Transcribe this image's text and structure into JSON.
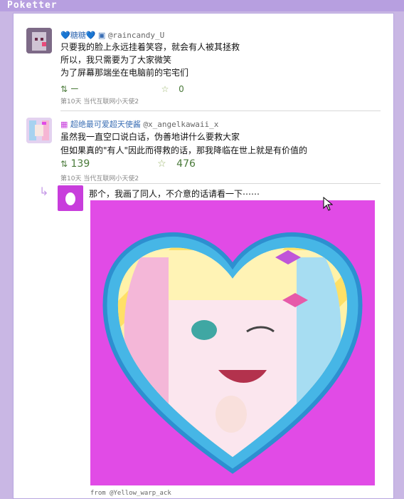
{
  "app": {
    "title": "Poketter"
  },
  "posts": [
    {
      "name": "💙糖糖💙",
      "handle": "@raincandy_U",
      "lines": [
        "只要我的脸上永远挂着笑容，就会有人被其拯救",
        "所以，我只需要为了大家微笑",
        "为了屏幕那端坐在电脑前的宅宅们"
      ],
      "retweets": "ー",
      "likes": "0",
      "meta": "第10天 当代互联网小天使2"
    },
    {
      "name": "超绝最可爱超天使酱",
      "handle": "@x_angelkawaii_x",
      "lines": [
        "虽然我一直空口说白话，伪善地讲什么要救大家",
        "但如果真的\"有人\"因此而得救的话，那我降临在世上就是有价值的"
      ],
      "retweets": "139",
      "likes": "476",
      "meta": "第10天 当代互联网小天使2"
    }
  ],
  "reply": {
    "text": "那个，我画了同人，不介意的话请看一下⋯⋯",
    "footer": "from @Yellow_warp_ack"
  }
}
